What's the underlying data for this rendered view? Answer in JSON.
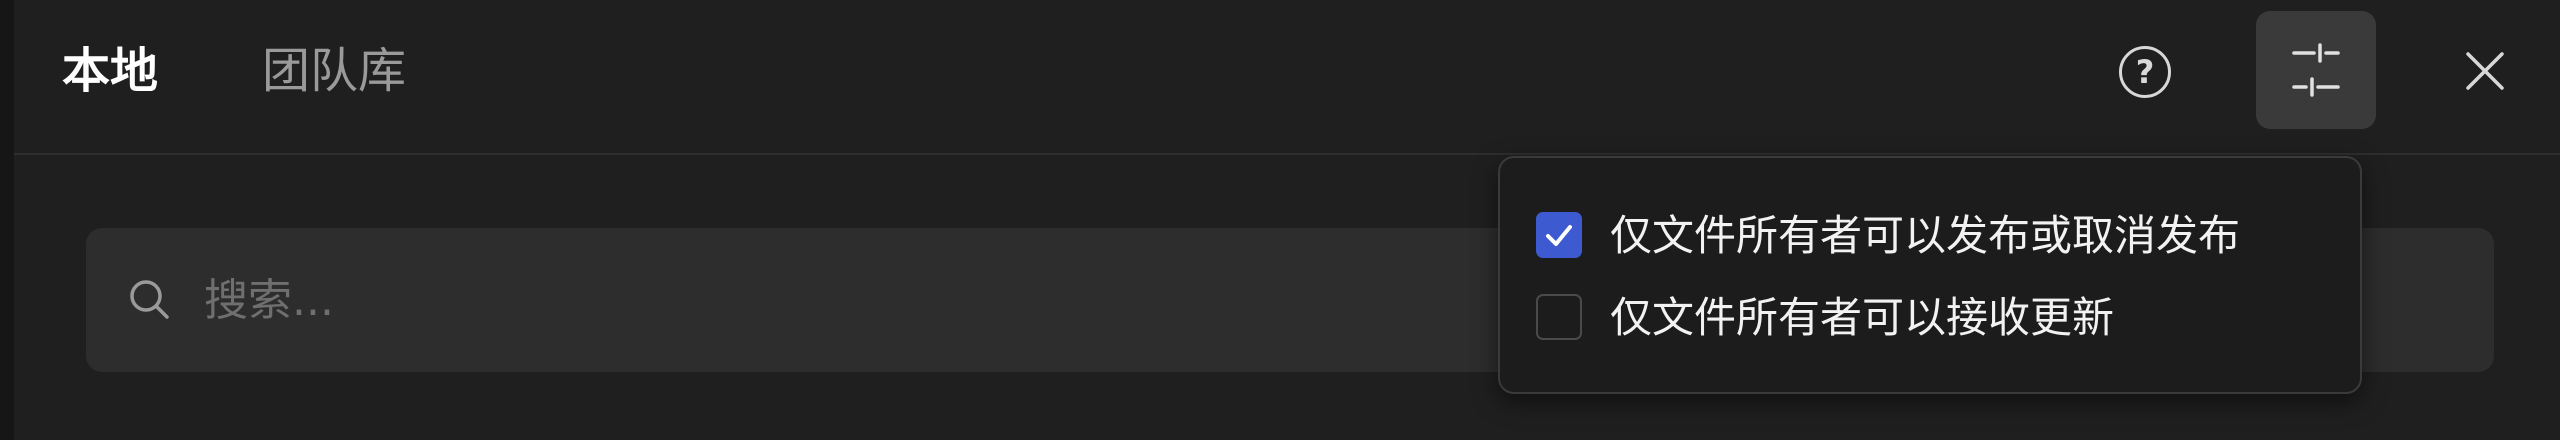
{
  "tabs": {
    "local": "本地",
    "team_library": "团队库"
  },
  "header": {
    "help_glyph": "?"
  },
  "search": {
    "placeholder": "搜索...",
    "value": ""
  },
  "settings_menu": {
    "options": [
      {
        "label": "仅文件所有者可以发布或取消发布",
        "checked": true
      },
      {
        "label": "仅文件所有者可以接收更新",
        "checked": false
      }
    ]
  },
  "colors": {
    "accent": "#3d5ad1",
    "background": "#1f1f1f",
    "search_bg": "#2d2d2d"
  },
  "icons": {
    "help": "question-circle-icon",
    "settings": "sliders-icon",
    "close": "close-icon",
    "search": "search-icon",
    "check": "check-icon"
  }
}
